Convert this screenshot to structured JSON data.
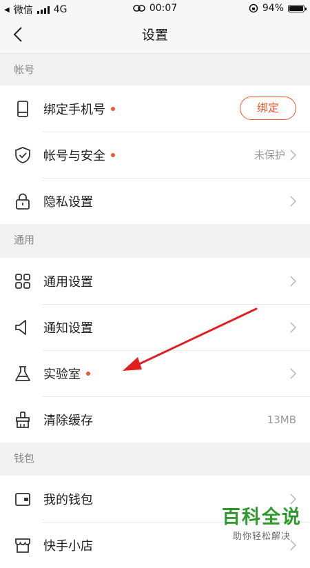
{
  "status_bar": {
    "carrier": "微信",
    "network": "4G",
    "time": "00:07",
    "battery": "94%",
    "battery_level": 0.94
  },
  "nav": {
    "title": "设置"
  },
  "sections": {
    "account": {
      "header": "帐号",
      "bind_phone": {
        "label": "绑定手机号",
        "button": "绑定"
      },
      "account_security": {
        "label": "帐号与安全",
        "value": "未保护"
      },
      "privacy": {
        "label": "隐私设置"
      }
    },
    "general": {
      "header": "通用",
      "general_settings": {
        "label": "通用设置"
      },
      "notification": {
        "label": "通知设置"
      },
      "lab": {
        "label": "实验室"
      },
      "clear_cache": {
        "label": "清除缓存",
        "value": "13MB"
      }
    },
    "wallet": {
      "header": "钱包",
      "my_wallet": {
        "label": "我的钱包"
      },
      "shop": {
        "label": "快手小店"
      }
    }
  },
  "watermark": {
    "title": "百科全说",
    "subtitle": "助你轻松解决"
  },
  "colors": {
    "accent": "#f0582b",
    "annotation_arrow": "#e02020",
    "watermark": "#2e9a2e"
  }
}
